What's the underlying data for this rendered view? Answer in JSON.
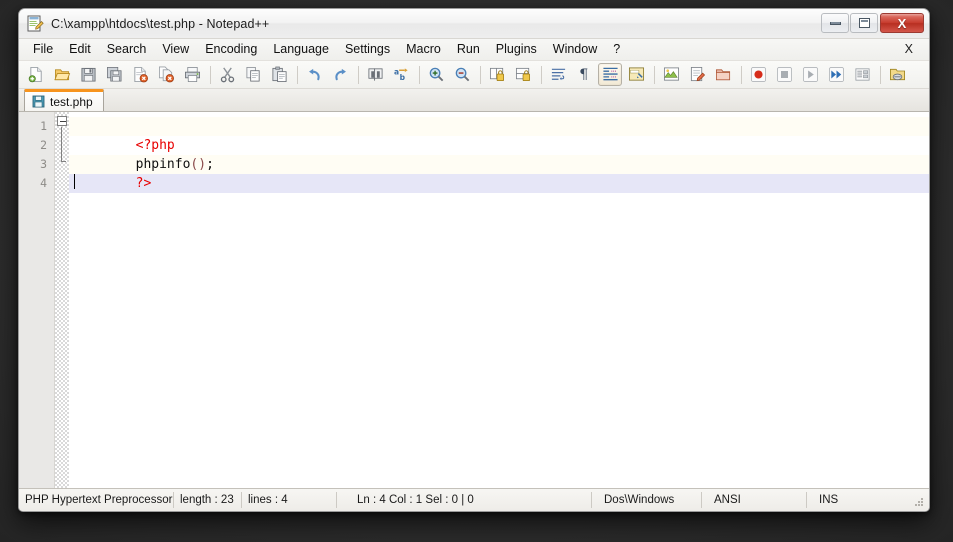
{
  "window": {
    "title": "C:\\xampp\\htdocs\\test.php - Notepad++",
    "app_icon": "notepad-plus-plus-icon",
    "controls": {
      "minimize_label": "–",
      "maximize_label": "□",
      "close_label": "X"
    }
  },
  "menubar": {
    "items": [
      {
        "label": "File"
      },
      {
        "label": "Edit"
      },
      {
        "label": "Search"
      },
      {
        "label": "View"
      },
      {
        "label": "Encoding"
      },
      {
        "label": "Language"
      },
      {
        "label": "Settings"
      },
      {
        "label": "Macro"
      },
      {
        "label": "Run"
      },
      {
        "label": "Plugins"
      },
      {
        "label": "Window"
      },
      {
        "label": "?"
      }
    ],
    "doc_close_label": "X"
  },
  "toolbar": {
    "icons": [
      "new-file-icon",
      "open-file-icon",
      "save-icon",
      "save-all-icon",
      "close-file-icon",
      "close-all-files-icon",
      "print-icon",
      "cut-icon",
      "copy-icon",
      "paste-icon",
      "undo-icon",
      "redo-icon",
      "find-icon",
      "replace-icon",
      "zoom-in-icon",
      "zoom-out-icon",
      "sync-vertical-scroll-icon",
      "sync-horizontal-scroll-icon",
      "word-wrap-icon",
      "show-all-characters-icon",
      "indent-guide-icon",
      "user-defined-dialog-icon",
      "document-map-icon",
      "function-list-icon",
      "folder-as-workspace-icon",
      "macro-record-icon",
      "macro-stop-icon",
      "macro-play-icon",
      "macro-playback-multiple-icon",
      "macro-save-icon",
      "run-icon"
    ]
  },
  "tabs": [
    {
      "label": "test.php",
      "icon": "saved-document-icon",
      "active": true
    }
  ],
  "editor": {
    "lines": [
      {
        "number": "1",
        "tokens": [
          {
            "text": "<?php",
            "type": "tag"
          }
        ],
        "php_tag_line": true,
        "current": false
      },
      {
        "number": "2",
        "tokens": [
          {
            "text": "phpinfo",
            "type": "fn"
          },
          {
            "text": "()",
            "type": "paren"
          },
          {
            "text": ";",
            "type": "semi"
          }
        ],
        "php_tag_line": false,
        "current": false
      },
      {
        "number": "3",
        "tokens": [
          {
            "text": "?>",
            "type": "tag"
          }
        ],
        "php_tag_line": true,
        "current": false
      },
      {
        "number": "4",
        "tokens": [],
        "php_tag_line": false,
        "current": true
      }
    ],
    "fold_marker": "collapse-fold-icon"
  },
  "statusbar": {
    "language": "PHP Hypertext Preprocessor",
    "length": "length : 23",
    "lines": "lines : 4",
    "position": "Ln : 4    Col : 1    Sel : 0 | 0",
    "eol": "Dos\\Windows",
    "encoding": "ANSI",
    "overtype": "INS",
    "grip": "resize-grip-icon"
  },
  "colors": {
    "tab_active_accent": "#f7941e",
    "php_tag": "#e80000",
    "current_line_highlight": "#e6e6f7",
    "php_tag_line_bg": "#fffdf4",
    "close_button": "#c63a2c",
    "gutter_bg": "#e9e8e6"
  }
}
